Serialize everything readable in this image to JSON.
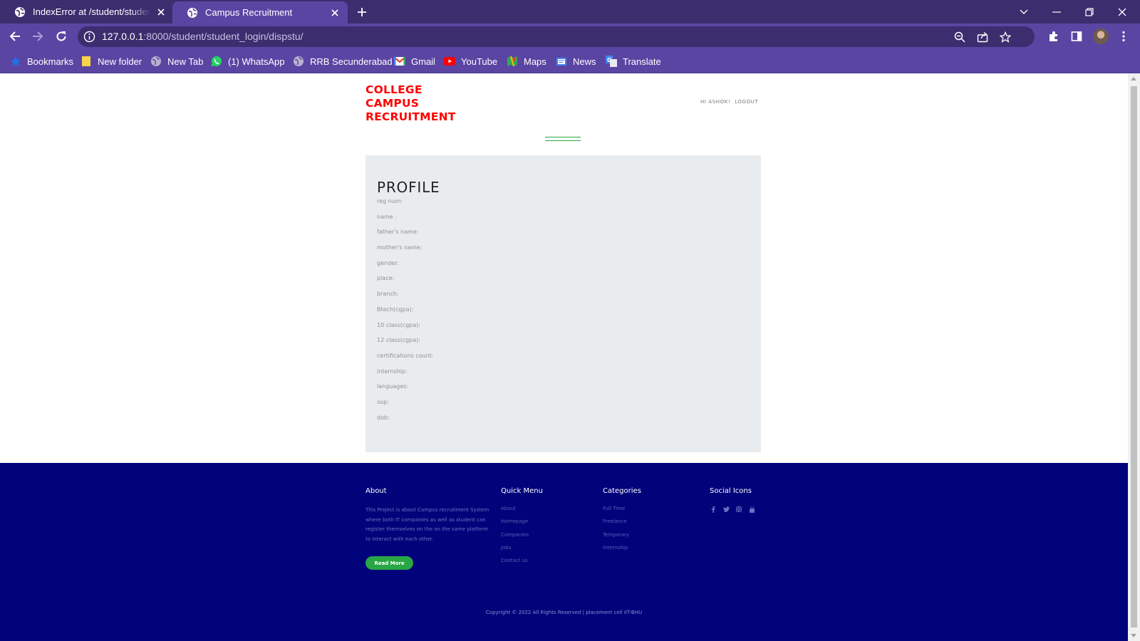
{
  "browser": {
    "tabs": [
      {
        "title": "IndexError at /student/student_lo",
        "active": false
      },
      {
        "title": "Campus Recruitment",
        "active": true
      }
    ],
    "url": {
      "host": "127.0.0.1",
      "rest": ":8000/student/student_login/dispstu/"
    },
    "bookmarks": [
      {
        "label": "Bookmarks",
        "icon": "star-icon"
      },
      {
        "label": "New folder",
        "icon": "folder-icon"
      },
      {
        "label": "New Tab",
        "icon": "globe-icon"
      },
      {
        "label": "(1) WhatsApp",
        "icon": "whatsapp-icon"
      },
      {
        "label": "RRB Secunderabad",
        "icon": "globe-icon"
      },
      {
        "label": "Gmail",
        "icon": "gmail-icon"
      },
      {
        "label": "YouTube",
        "icon": "youtube-icon"
      },
      {
        "label": "Maps",
        "icon": "maps-icon"
      },
      {
        "label": "News",
        "icon": "news-icon"
      },
      {
        "label": "Translate",
        "icon": "translate-icon"
      }
    ]
  },
  "page": {
    "brand": {
      "line1": "COLLEGE",
      "line2": "CAMPUS",
      "line3": "RECRUITMENT"
    },
    "user": {
      "greeting": "HI ASHOK!",
      "logout": "LOGOUT"
    },
    "profile": {
      "title": "PROFILE",
      "fields": [
        "reg num:",
        "name :",
        "father's name:",
        "mother's name:",
        "gender:",
        "place:",
        "branch:",
        "Btech(cgpa):",
        "10 class(cgpa):",
        "12 class(cgpa):",
        "certifications count:",
        "internship:",
        "languages:",
        "sop:",
        "dob:"
      ]
    },
    "footer": {
      "about": {
        "heading": "About",
        "text": "This Project is about Campus recruitment System where both IT companies as well as student can register themselves on the on the same platform to interact with each other.",
        "button": "Read More"
      },
      "quick_menu": {
        "heading": "Quick Menu",
        "links": [
          "About",
          "Homepage",
          "Companies",
          "Jobs",
          "Contact us"
        ]
      },
      "categories": {
        "heading": "Categories",
        "links": [
          "Full Time",
          "Freelance",
          "Temporary",
          "Internship"
        ]
      },
      "social": {
        "heading": "Social Icons",
        "icons": [
          "facebook-icon",
          "twitter-icon",
          "instagram-icon",
          "youtube-icon"
        ]
      },
      "copyright": "Copyright © 2022 All Rights Reserved | placement cell IIT-BHU"
    }
  },
  "colors": {
    "chrome_dark": "#3b2d6e",
    "chrome_light": "#5b45a3",
    "brand_red": "#ff0000",
    "footer_blue": "#01037a",
    "accent_green": "#28a745",
    "card_gray": "#e9ecef"
  }
}
